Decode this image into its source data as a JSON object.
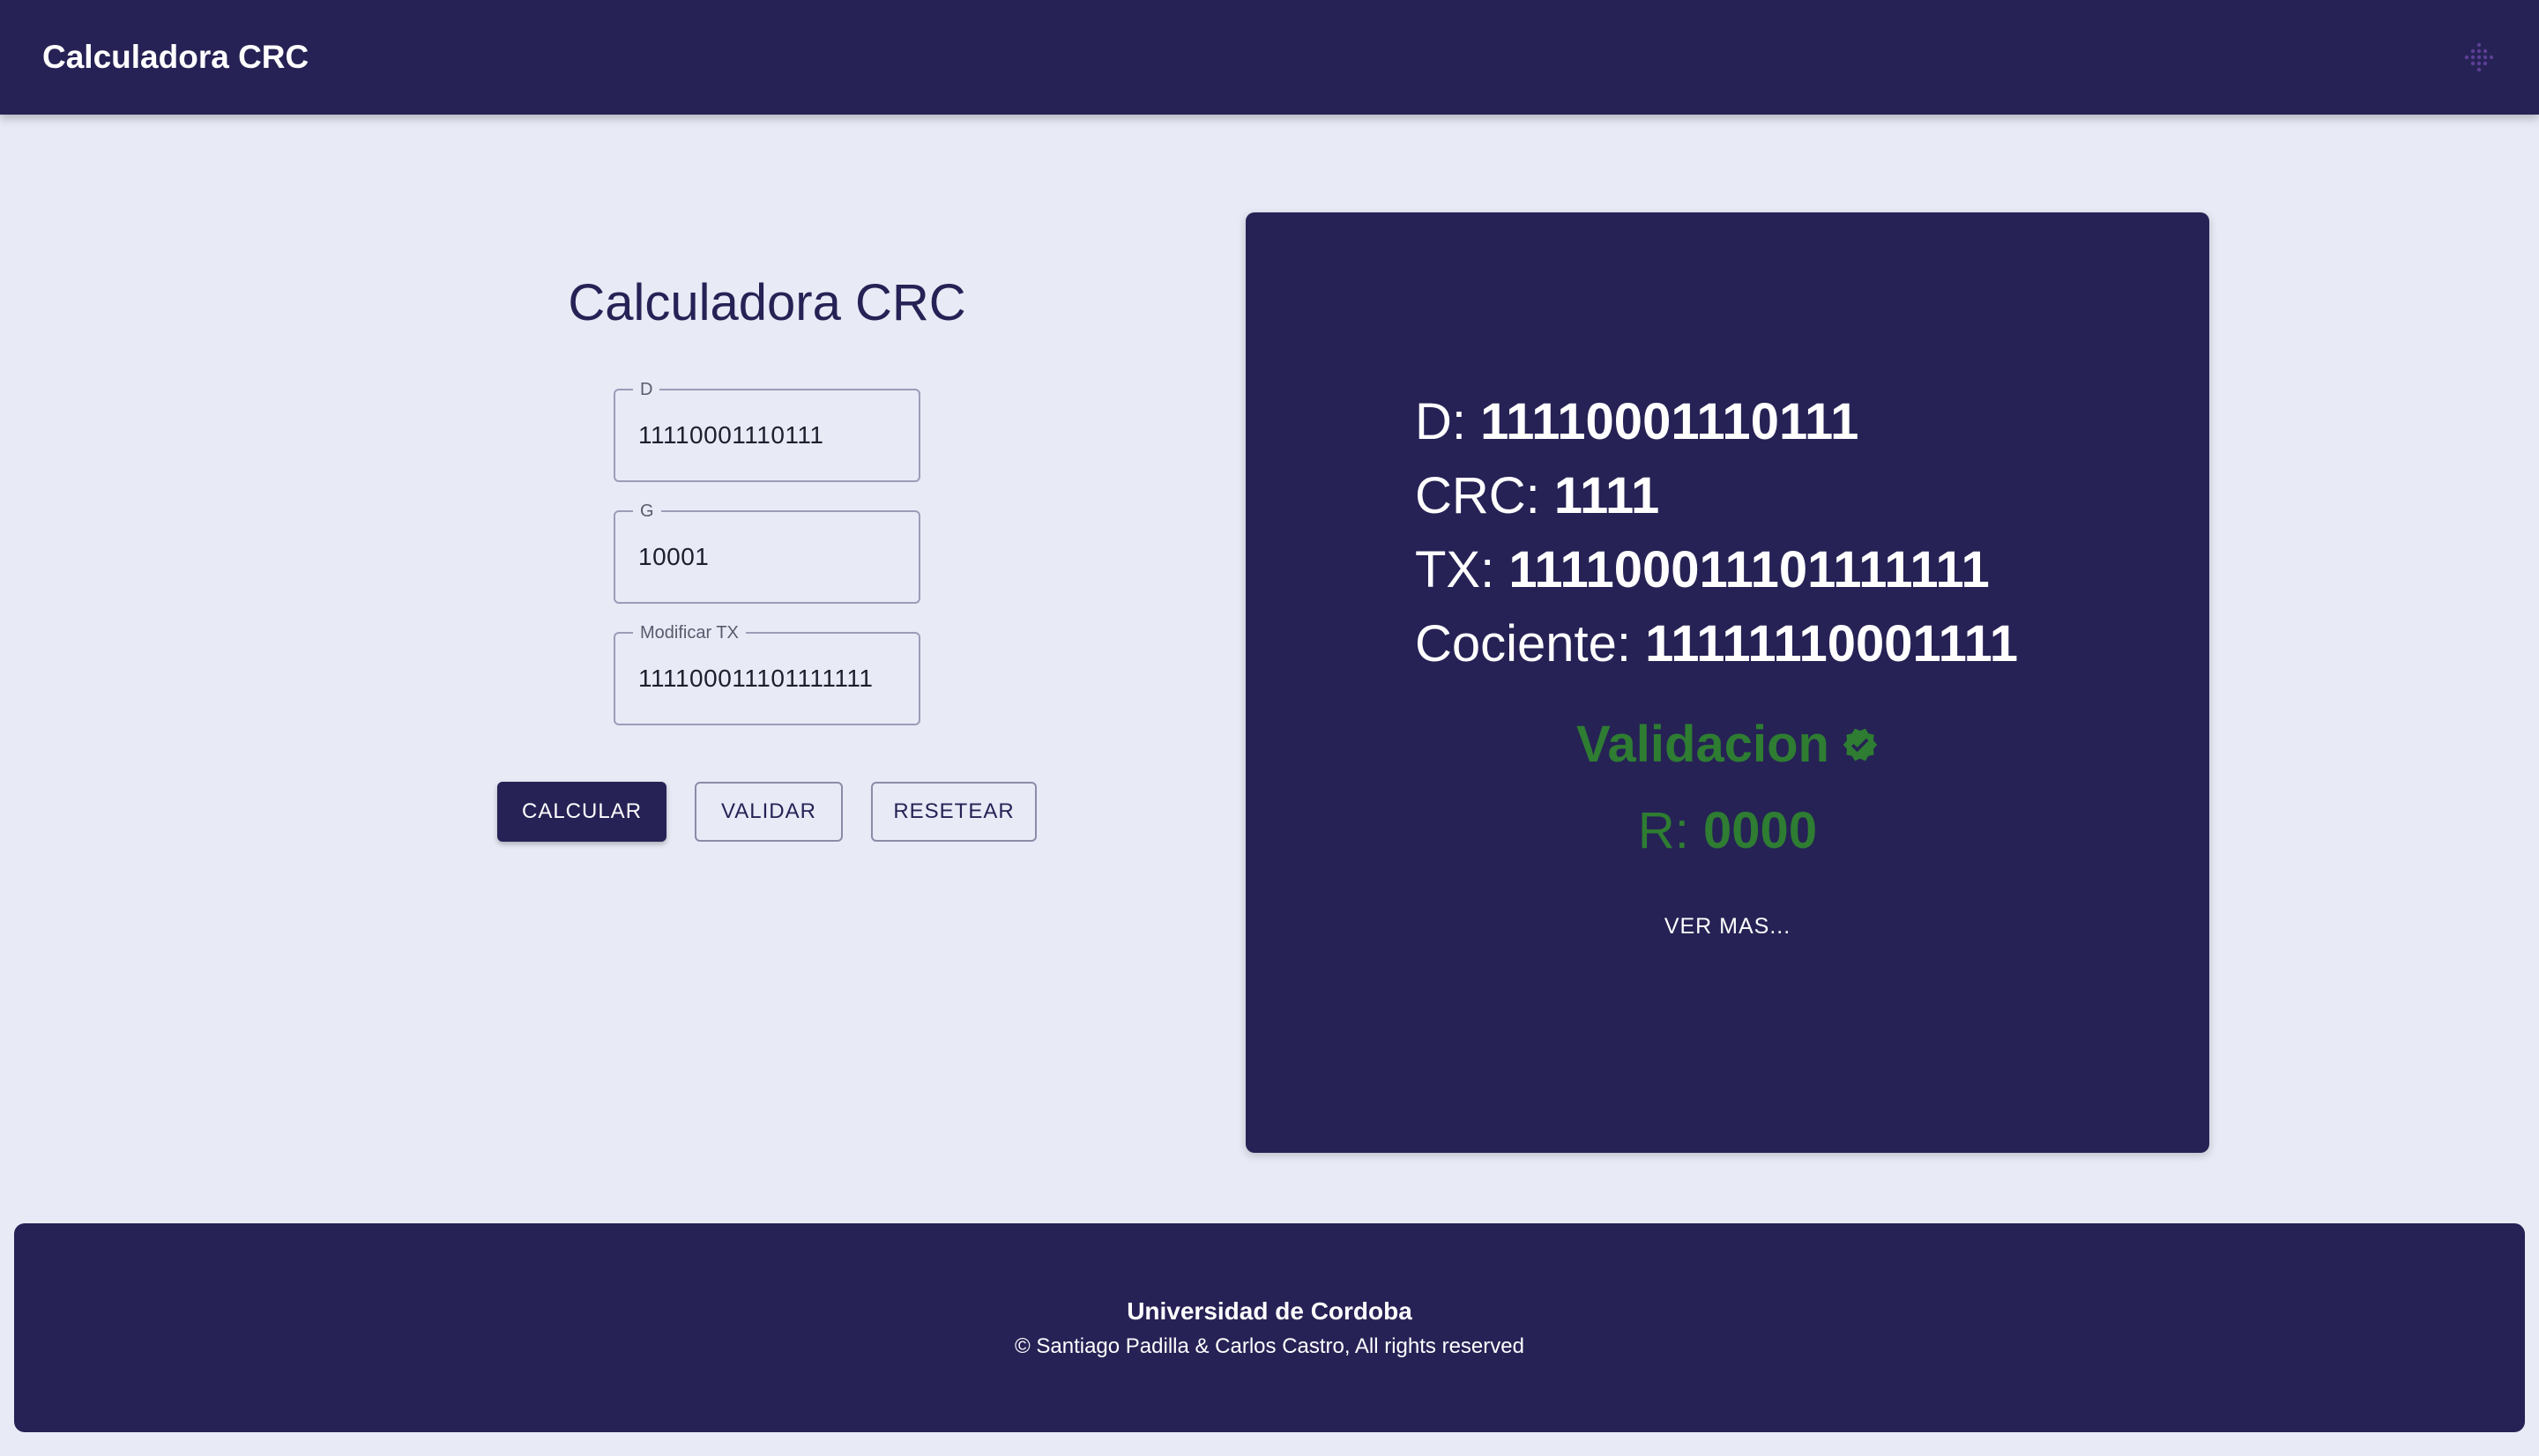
{
  "appbar": {
    "title": "Calculadora CRC",
    "menu_icon": "dots-grid-icon"
  },
  "form": {
    "title": "Calculadora CRC",
    "fields": [
      {
        "label": "D",
        "value": "11110001110111"
      },
      {
        "label": "G",
        "value": "10001"
      },
      {
        "label": "Modificar TX",
        "value": "111100011101111111"
      }
    ],
    "buttons": {
      "calcular": "CALCULAR",
      "validar": "VALIDAR",
      "resetear": "RESETEAR"
    }
  },
  "result": {
    "d_label": "D: ",
    "d_value": "11110001110111",
    "crc_label": "CRC: ",
    "crc_value": "1111",
    "tx_label": "TX: ",
    "tx_value": "111100011101111111",
    "cociente_label": "Cociente: ",
    "cociente_value": "11111110001111",
    "validation_text": "Validacion",
    "validation_icon": "verified-check-icon",
    "r_label": "R: ",
    "r_value": "0000",
    "ver_mas": "VER MAS..."
  },
  "footer": {
    "title": "Universidad de Cordoba",
    "copyright": "© Santiago Padilla & Carlos Castro, All rights reserved"
  },
  "colors": {
    "primary": "#262255",
    "background": "#e8eaf6",
    "success": "#2e7d32"
  }
}
